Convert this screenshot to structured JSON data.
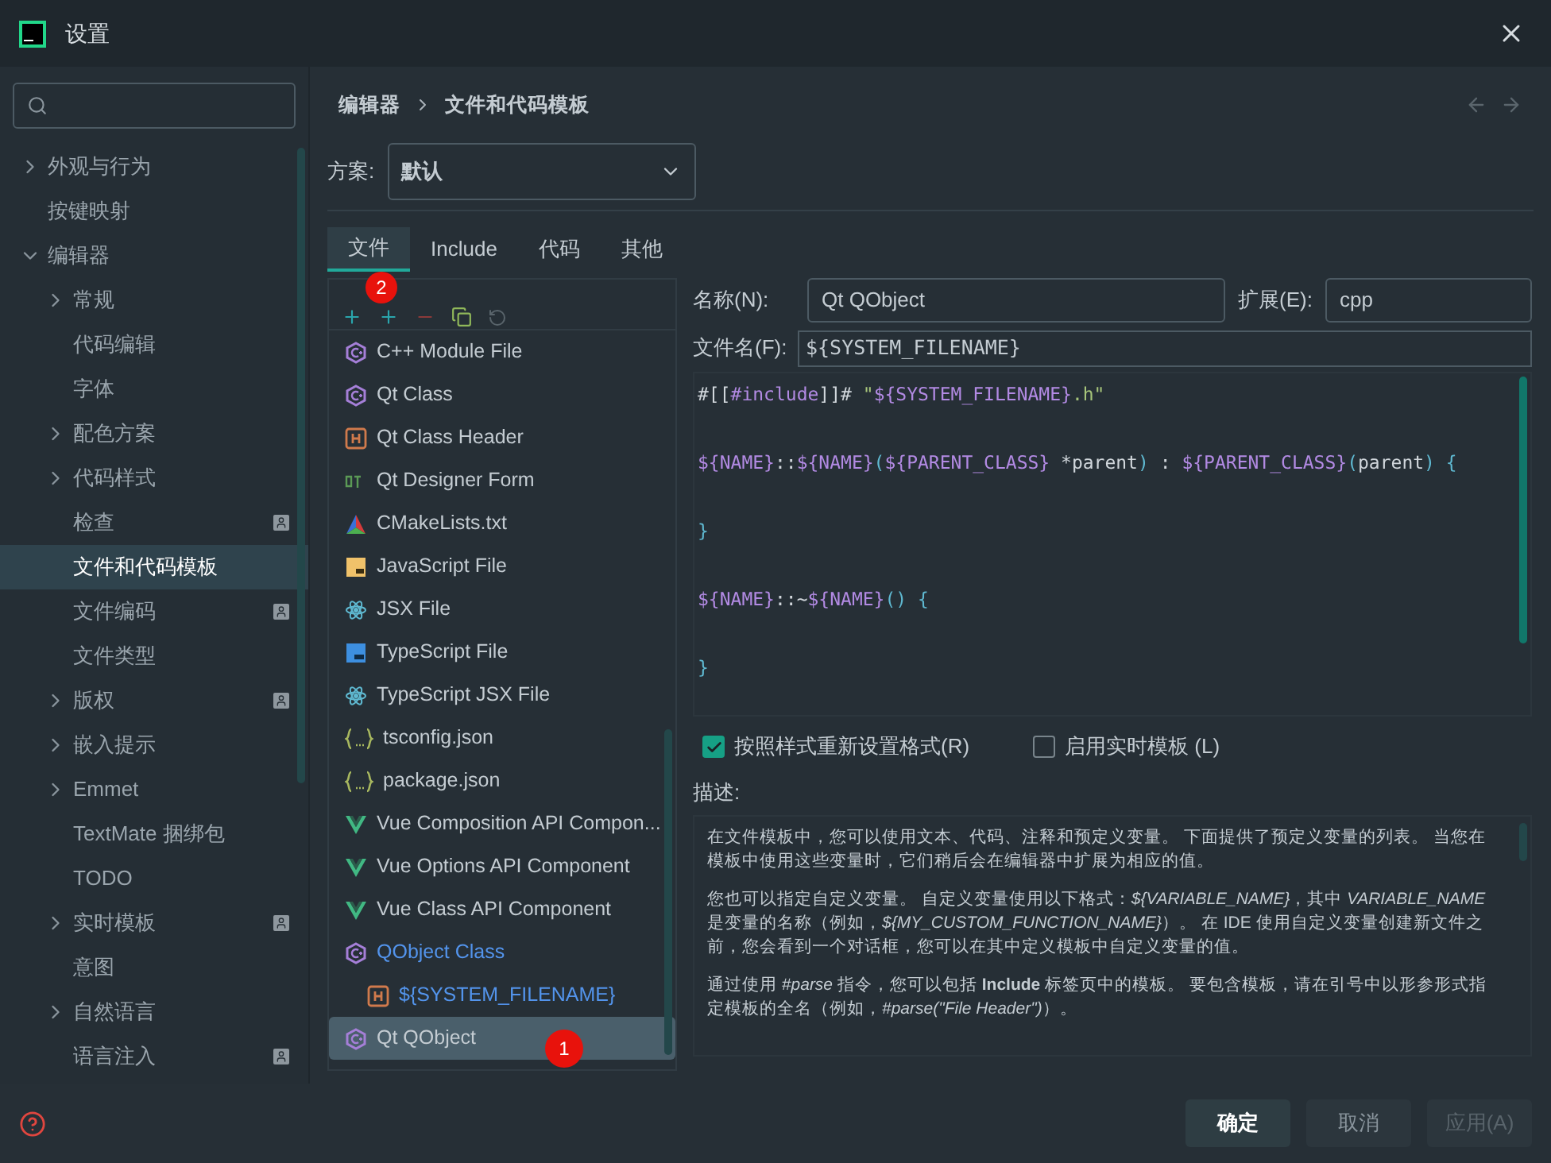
{
  "window": {
    "title": "设置"
  },
  "sidebar": {
    "items": [
      {
        "label": "外观与行为",
        "expanded": false,
        "selected": false
      },
      {
        "label": "按键映射",
        "selected": false
      },
      {
        "label": "编辑器",
        "expanded": true,
        "selected": false,
        "children": [
          {
            "label": "常规",
            "expanded": false,
            "selected": false
          },
          {
            "label": "代码编辑",
            "selected": false
          },
          {
            "label": "字体",
            "selected": false
          },
          {
            "label": "配色方案",
            "expanded": false,
            "selected": false
          },
          {
            "label": "代码样式",
            "expanded": false,
            "selected": false
          },
          {
            "label": "检查",
            "selected": false,
            "project_icon": true
          },
          {
            "label": "文件和代码模板",
            "selected": true
          },
          {
            "label": "文件编码",
            "selected": false,
            "project_icon": true
          },
          {
            "label": "文件类型",
            "selected": false
          },
          {
            "label": "版权",
            "expanded": false,
            "selected": false,
            "project_icon": true
          },
          {
            "label": "嵌入提示",
            "expanded": false,
            "selected": false
          },
          {
            "label": "Emmet",
            "expanded": false,
            "selected": false
          },
          {
            "label": "TextMate 捆绑包",
            "selected": false
          },
          {
            "label": "TODO",
            "selected": false
          },
          {
            "label": "实时模板",
            "expanded": false,
            "selected": false,
            "project_icon": true
          },
          {
            "label": "意图",
            "selected": false
          },
          {
            "label": "自然语言",
            "expanded": false,
            "selected": false
          },
          {
            "label": "语言注入",
            "selected": false,
            "project_icon": true
          }
        ]
      }
    ]
  },
  "breadcrumb": [
    "编辑器",
    "文件和代码模板"
  ],
  "scheme": {
    "label": "方案:",
    "value": "默认"
  },
  "tabs": [
    {
      "label": "文件",
      "selected": true
    },
    {
      "label": "Include",
      "selected": false
    },
    {
      "label": "代码",
      "selected": false
    },
    {
      "label": "其他",
      "selected": false
    }
  ],
  "templates": [
    {
      "name": "C++ Module File",
      "kind": "cpp",
      "selected": false
    },
    {
      "name": "Qt Class",
      "kind": "cpp",
      "selected": false
    },
    {
      "name": "Qt Class Header",
      "kind": "header",
      "selected": false
    },
    {
      "name": "Qt Designer Form",
      "kind": "qt",
      "selected": false
    },
    {
      "name": "CMakeLists.txt",
      "kind": "cmake",
      "selected": false
    },
    {
      "name": "JavaScript File",
      "kind": "js",
      "selected": false
    },
    {
      "name": "JSX File",
      "kind": "react",
      "selected": false
    },
    {
      "name": "TypeScript File",
      "kind": "ts",
      "selected": false
    },
    {
      "name": "TypeScript JSX File",
      "kind": "react",
      "selected": false
    },
    {
      "name": "tsconfig.json",
      "kind": "json",
      "selected": false
    },
    {
      "name": "package.json",
      "kind": "json",
      "selected": false
    },
    {
      "name": "Vue Composition API Compon...",
      "kind": "vue",
      "selected": false
    },
    {
      "name": "Vue Options API Component",
      "kind": "vue",
      "selected": false
    },
    {
      "name": "Vue Class API Component",
      "kind": "vue",
      "selected": false
    },
    {
      "name": "QObject Class",
      "kind": "cpp",
      "selected": false,
      "modified": true,
      "children": [
        {
          "name": "${SYSTEM_FILENAME}",
          "kind": "header",
          "selected": false,
          "modified": true
        }
      ]
    },
    {
      "name": "Qt QObject",
      "kind": "cpp",
      "selected": true
    }
  ],
  "annotations": [
    {
      "text": "2"
    },
    {
      "text": "1"
    }
  ],
  "form": {
    "name_label": "名称(N):",
    "name": "Qt QObject",
    "ext_label": "扩展(E):",
    "ext": "cpp",
    "filename_label": "文件名(F):",
    "filename": "${SYSTEM_FILENAME}"
  },
  "code": [
    [
      {
        "text": "#[[",
        "kind": "plain"
      },
      {
        "text": "#include",
        "kind": "var"
      },
      {
        "text": "]]# ",
        "kind": "plain"
      },
      {
        "text": "\"",
        "kind": "string"
      },
      {
        "text": "${SYSTEM_FILENAME}",
        "kind": "var"
      },
      {
        "text": ".h\"",
        "kind": "string"
      }
    ],
    [
      {
        "text": "${NAME}",
        "kind": "var"
      },
      {
        "text": "::",
        "kind": "plain"
      },
      {
        "text": "${NAME}",
        "kind": "var"
      },
      {
        "text": "(",
        "kind": "punct"
      },
      {
        "text": "${PARENT_CLASS}",
        "kind": "var"
      },
      {
        "text": " *parent",
        "kind": "plain"
      },
      {
        "text": ")",
        "kind": "punct"
      },
      {
        "text": " : ",
        "kind": "plain"
      },
      {
        "text": "${PARENT_CLASS}",
        "kind": "var"
      },
      {
        "text": "(",
        "kind": "punct"
      },
      {
        "text": "parent",
        "kind": "plain"
      },
      {
        "text": ") {",
        "kind": "punct"
      }
    ],
    [
      {
        "text": "}",
        "kind": "punct"
      }
    ],
    [
      {
        "text": "${NAME}",
        "kind": "var"
      },
      {
        "text": "::~",
        "kind": "plain"
      },
      {
        "text": "${NAME}",
        "kind": "var"
      },
      {
        "text": "() {",
        "kind": "punct"
      }
    ],
    [
      {
        "text": "}",
        "kind": "punct"
      }
    ]
  ],
  "options": [
    {
      "label": "按照样式重新设置格式(R)",
      "checked": true
    },
    {
      "label": "启用实时模板 (L)",
      "checked": false
    }
  ],
  "description": {
    "label": "描述:",
    "paragraphs": [
      "在文件模板中，您可以使用文本、代码、注释和预定义变量。 下面提供了预定义变量的列表。 当您在模板中使用这些变量时，它们稍后会在编辑器中扩展为相应的值。",
      "您也可以指定自定义变量。 自定义变量使用以下格式：*${VARIABLE_NAME}*，其中 *VARIABLE_NAME* 是变量的名称（例如，*${MY_CUSTOM_FUNCTION_NAME}*）。 在 IDE 使用自定义变量创建新文件之前，您会看到一个对话框，您可以在其中定义模板中自定义变量的值。",
      "通过使用 *#parse* 指令，您可以包括 **Include** 标签页中的模板。 要包含模板，请在引号中以形参形式指定模板的全名（例如，*#parse(\"File Header\")*）。"
    ]
  },
  "buttons": [
    {
      "label": "确定",
      "disabled": false,
      "primary": true
    },
    {
      "label": "取消",
      "disabled": false,
      "primary": false
    },
    {
      "label": "应用(A)",
      "disabled": true,
      "primary": false
    }
  ]
}
